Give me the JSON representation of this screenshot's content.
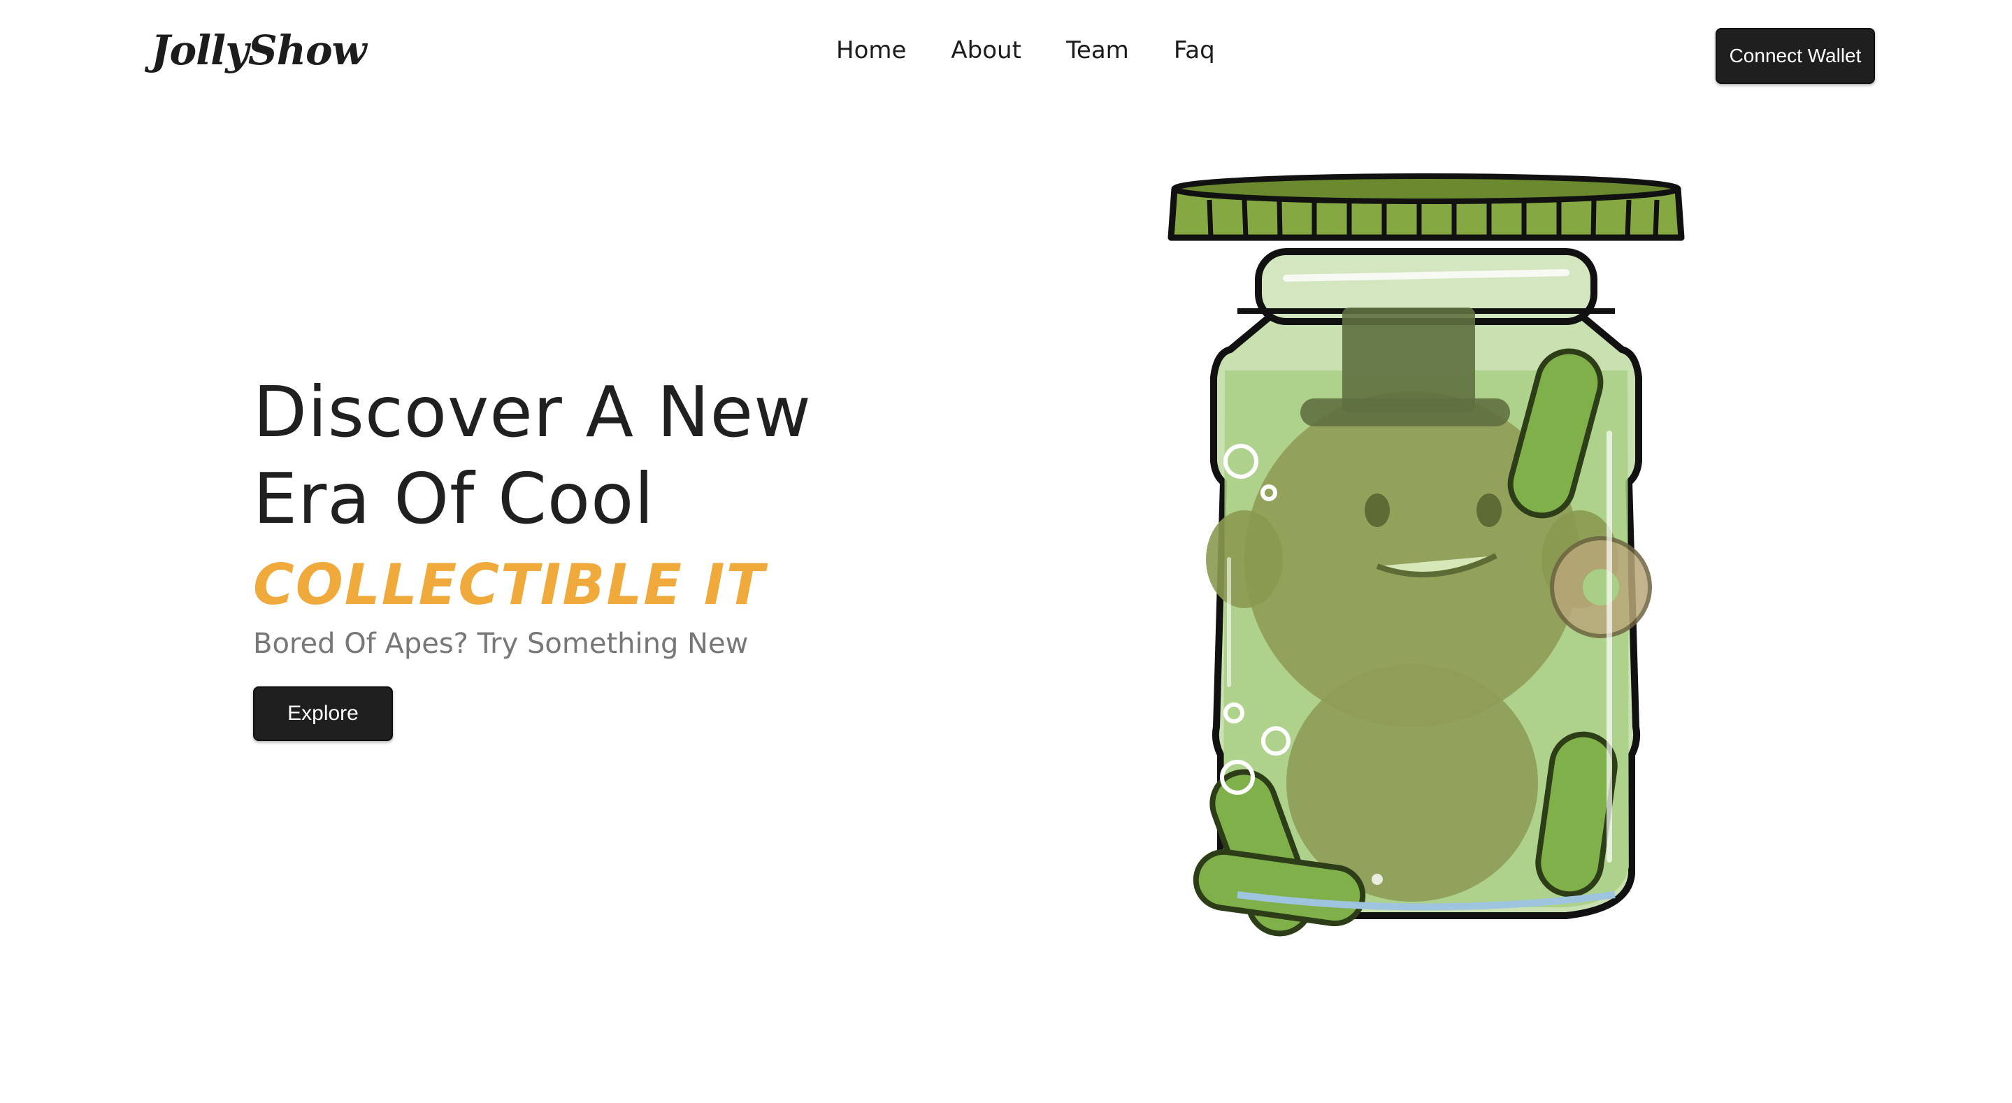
{
  "header": {
    "logo_text": "JollyShow",
    "nav": [
      {
        "label": "Home"
      },
      {
        "label": "About"
      },
      {
        "label": "Team"
      },
      {
        "label": "Faq"
      }
    ],
    "connect_button_label": "Connect Wallet"
  },
  "hero": {
    "title_line_1": "Discover A New",
    "title_line_2": "Era Of Cool",
    "accent_text": "COLLECTIBLE IT",
    "subtitle": "Bored Of Apes? Try Something New",
    "explore_button_label": "Explore",
    "image_name": "pickle-jar-character-illustration"
  },
  "colors": {
    "accent": "#f0a93b",
    "button_bg": "#1f1f1f",
    "text": "#202020",
    "subtitle": "#777777",
    "jar_lid": "#7a9a3a",
    "jar_glass": "#c9e0b0"
  }
}
